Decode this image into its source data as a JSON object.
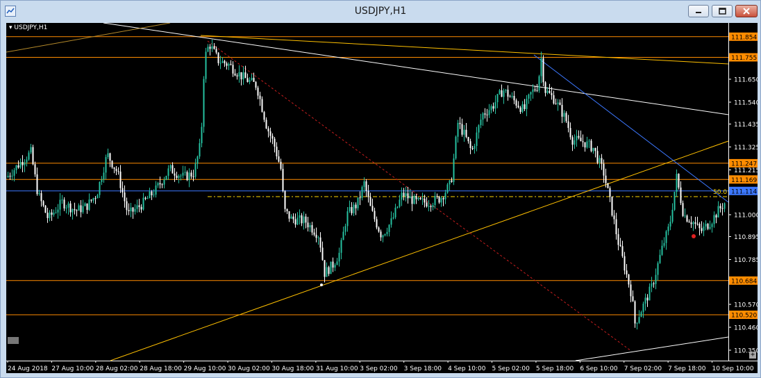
{
  "window": {
    "title": "USDJPY,H1"
  },
  "chart": {
    "symbol_label": "USDJPY,H1",
    "fib_label": "50.0",
    "colors": {
      "background": "#000000",
      "bull": "#26c0a0",
      "bear": "#ffffff",
      "grid_text": "#ffffff",
      "hline": "#ff8c00",
      "tag_bg": "#ff8c00",
      "blue_line": "#3c78ff",
      "channel": "#ffc000",
      "white_line": "#ffffff",
      "red_dash": "#c81e1e"
    }
  },
  "chart_data": {
    "type": "candlestick",
    "symbol": "USDJPY",
    "timeframe": "H1",
    "ylim": [
      110.3,
      111.92
    ],
    "price_ticks": [
      "111.650",
      "111.540",
      "111.435",
      "111.325",
      "111.215",
      "111.000",
      "110.895",
      "110.785",
      "110.570",
      "110.460",
      "110.350"
    ],
    "horizontal_levels": [
      {
        "label": "111.854",
        "value": 111.854,
        "color": "#ff8c00"
      },
      {
        "label": "111.755",
        "value": 111.755,
        "color": "#ff8c00"
      },
      {
        "label": "111.247",
        "value": 111.247,
        "color": "#ff8c00"
      },
      {
        "label": "111.169",
        "value": 111.169,
        "color": "#ff8c00"
      },
      {
        "label": "111.114",
        "value": 111.114,
        "color": "#3c78ff"
      },
      {
        "label": "110.684",
        "value": 110.684,
        "color": "#ff8c00"
      },
      {
        "label": "110.520",
        "value": 110.52,
        "color": "#ff8c00"
      }
    ],
    "time_labels": [
      "24 Aug 2018",
      "27 Aug 10:00",
      "28 Aug 02:00",
      "28 Aug 18:00",
      "29 Aug 10:00",
      "30 Aug 02:00",
      "30 Aug 18:00",
      "31 Aug 10:00",
      "3 Sep 02:00",
      "3 Sep 18:00",
      "4 Sep 10:00",
      "5 Sep 02:00",
      "5 Sep 18:00",
      "6 Sep 10:00",
      "7 Sep 02:00",
      "7 Sep 18:00",
      "10 Sep 10:00"
    ],
    "price_path": [
      [
        0,
        111.18
      ],
      [
        20,
        111.25
      ],
      [
        35,
        111.3
      ],
      [
        45,
        111.1
      ],
      [
        60,
        110.98
      ],
      [
        80,
        111.06
      ],
      [
        100,
        111.02
      ],
      [
        115,
        111.04
      ],
      [
        130,
        111.1
      ],
      [
        145,
        111.29
      ],
      [
        160,
        111.2
      ],
      [
        175,
        111.0
      ],
      [
        195,
        111.05
      ],
      [
        215,
        111.12
      ],
      [
        235,
        111.22
      ],
      [
        255,
        111.18
      ],
      [
        270,
        111.2
      ],
      [
        280,
        111.35
      ],
      [
        285,
        111.75
      ],
      [
        292,
        111.82
      ],
      [
        305,
        111.74
      ],
      [
        320,
        111.72
      ],
      [
        340,
        111.66
      ],
      [
        360,
        111.62
      ],
      [
        375,
        111.42
      ],
      [
        385,
        111.34
      ],
      [
        395,
        111.22
      ],
      [
        400,
        111.02
      ],
      [
        410,
        110.98
      ],
      [
        430,
        110.97
      ],
      [
        450,
        110.9
      ],
      [
        458,
        110.72
      ],
      [
        470,
        110.76
      ],
      [
        480,
        110.82
      ],
      [
        490,
        111.0
      ],
      [
        505,
        111.05
      ],
      [
        515,
        111.15
      ],
      [
        525,
        111.02
      ],
      [
        540,
        110.9
      ],
      [
        555,
        110.97
      ],
      [
        570,
        111.1
      ],
      [
        590,
        111.06
      ],
      [
        610,
        111.06
      ],
      [
        625,
        111.08
      ],
      [
        640,
        111.15
      ],
      [
        650,
        111.44
      ],
      [
        660,
        111.38
      ],
      [
        670,
        111.3
      ],
      [
        685,
        111.48
      ],
      [
        700,
        111.52
      ],
      [
        715,
        111.6
      ],
      [
        730,
        111.55
      ],
      [
        745,
        111.5
      ],
      [
        755,
        111.58
      ],
      [
        765,
        111.62
      ],
      [
        770,
        111.75
      ],
      [
        775,
        111.6
      ],
      [
        790,
        111.55
      ],
      [
        805,
        111.46
      ],
      [
        815,
        111.36
      ],
      [
        830,
        111.35
      ],
      [
        845,
        111.32
      ],
      [
        860,
        111.2
      ],
      [
        870,
        111.05
      ],
      [
        880,
        110.88
      ],
      [
        890,
        110.75
      ],
      [
        900,
        110.62
      ],
      [
        905,
        110.48
      ],
      [
        915,
        110.55
      ],
      [
        930,
        110.66
      ],
      [
        945,
        110.85
      ],
      [
        955,
        110.95
      ],
      [
        965,
        111.18
      ],
      [
        975,
        111.0
      ],
      [
        990,
        110.96
      ],
      [
        1000,
        110.92
      ],
      [
        1015,
        110.97
      ],
      [
        1025,
        111.02
      ],
      [
        1035,
        111.06
      ]
    ]
  }
}
